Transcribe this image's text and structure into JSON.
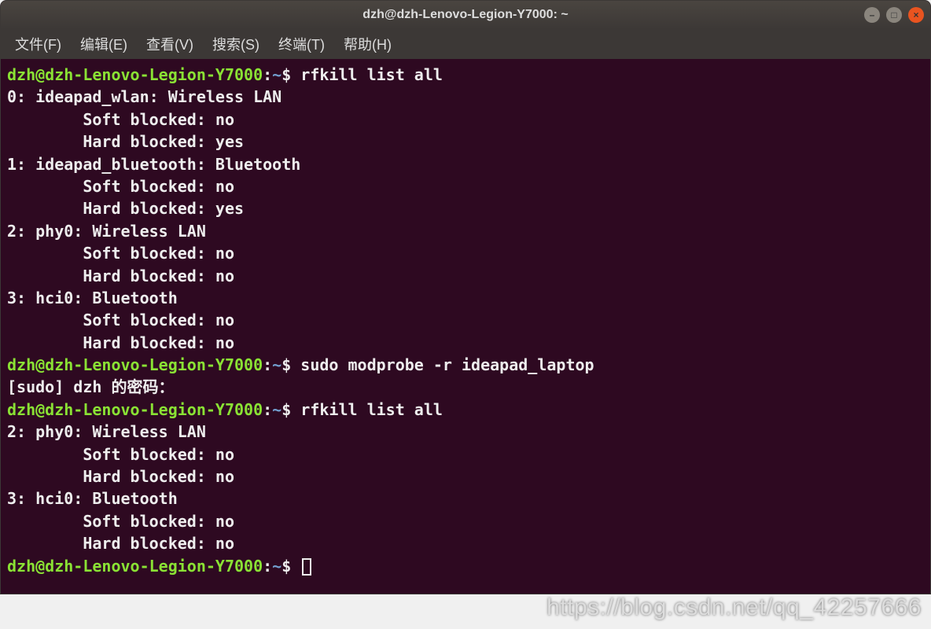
{
  "titlebar": {
    "title": "dzh@dzh-Lenovo-Legion-Y7000: ~"
  },
  "menubar": {
    "items": [
      "文件(F)",
      "编辑(E)",
      "查看(V)",
      "搜索(S)",
      "终端(T)",
      "帮助(H)"
    ]
  },
  "prompt": {
    "userhost": "dzh@dzh-Lenovo-Legion-Y7000",
    "colon": ":",
    "path": "~",
    "dollar": "$"
  },
  "lines": {
    "cmd1": " rfkill list all",
    "out1": "0: ideapad_wlan: Wireless LAN",
    "out2": "        Soft blocked: no",
    "out3": "        Hard blocked: yes",
    "out4": "1: ideapad_bluetooth: Bluetooth",
    "out5": "        Soft blocked: no",
    "out6": "        Hard blocked: yes",
    "out7": "2: phy0: Wireless LAN",
    "out8": "        Soft blocked: no",
    "out9": "        Hard blocked: no",
    "out10": "3: hci0: Bluetooth",
    "out11": "        Soft blocked: no",
    "out12": "        Hard blocked: no",
    "cmd2": " sudo modprobe -r ideapad_laptop",
    "out13": "[sudo] dzh 的密码：",
    "cmd3": " rfkill list all",
    "out14": "2: phy0: Wireless LAN",
    "out15": "        Soft blocked: no",
    "out16": "        Hard blocked: no",
    "out17": "3: hci0: Bluetooth",
    "out18": "        Soft blocked: no",
    "out19": "        Hard blocked: no",
    "cmd4": " "
  },
  "watermark": "https://blog.csdn.net/qq_42257666"
}
